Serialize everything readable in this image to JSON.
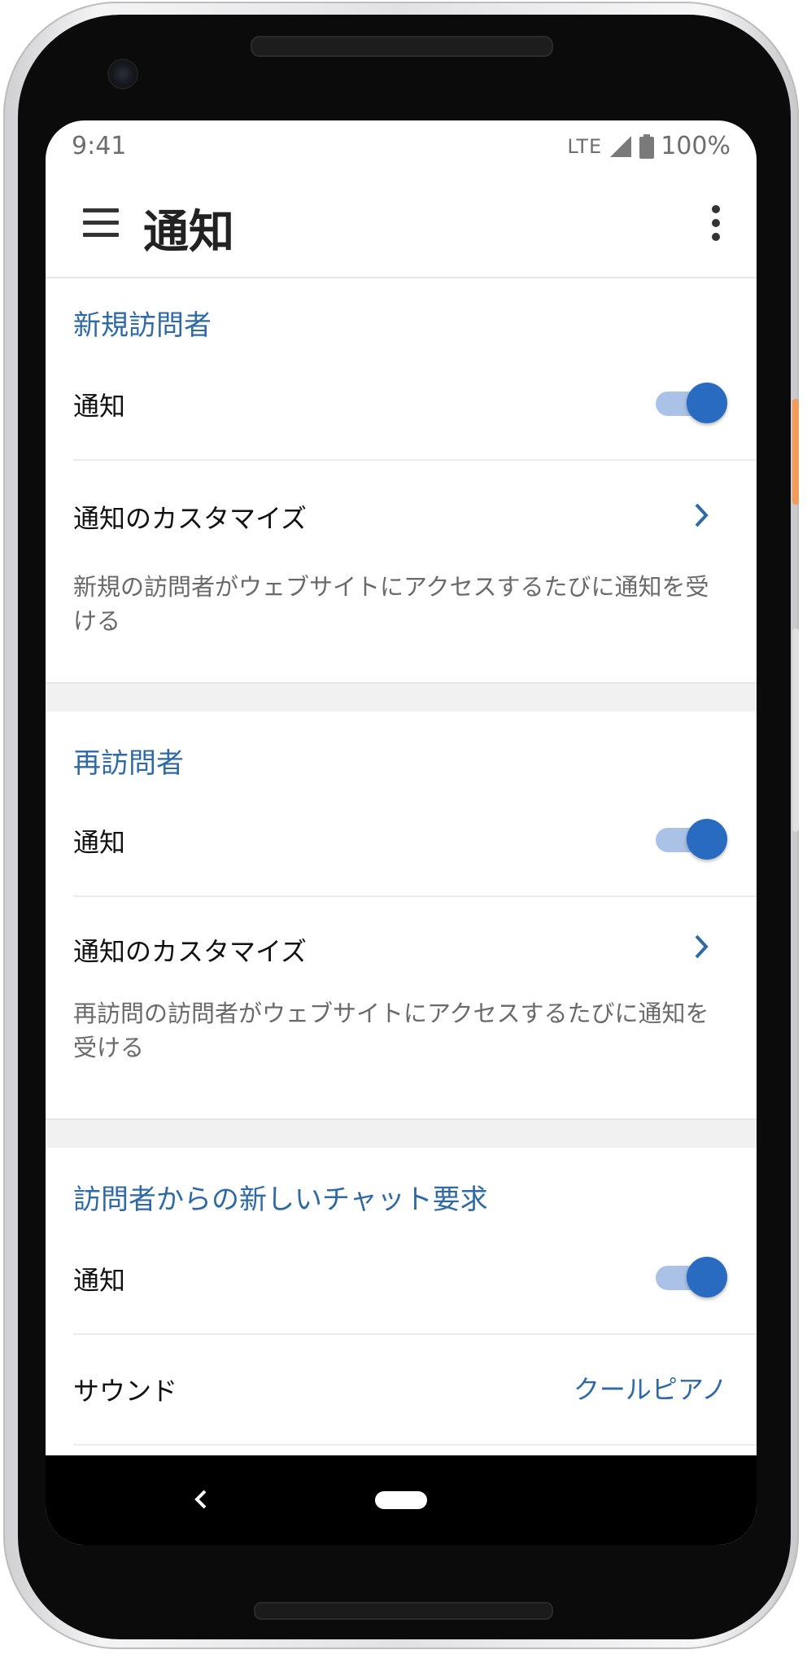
{
  "status_bar": {
    "time": "9:41",
    "network": "LTE",
    "battery": "100%"
  },
  "app_bar": {
    "title": "通知"
  },
  "sections": [
    {
      "title": "新規訪問者",
      "notify_label": "通知",
      "notify_on": true,
      "customize_label": "通知のカスタマイズ",
      "description": "新規の訪問者がウェブサイトにアクセスするたびに通知を受ける"
    },
    {
      "title": "再訪問者",
      "notify_label": "通知",
      "notify_on": true,
      "customize_label": "通知のカスタマイズ",
      "description": "再訪問の訪問者がウェブサイトにアクセスするたびに通知を受ける"
    },
    {
      "title": "訪問者からの新しいチャット要求",
      "notify_label": "通知",
      "notify_on": true,
      "sound_label": "サウンド",
      "sound_value": "クールピアノ"
    }
  ],
  "colors": {
    "accent": "#2e6aa6",
    "toggle_thumb": "#2a6bc2",
    "toggle_track": "#a9c2e6",
    "section_gap": "#f1f1f1"
  },
  "icons": {
    "menu": "hamburger-menu-icon",
    "more": "more-vert-icon",
    "chevron": "chevron-right-icon",
    "back": "back-icon",
    "home": "home-pill-icon",
    "signal": "signal-icon",
    "battery": "battery-icon"
  }
}
